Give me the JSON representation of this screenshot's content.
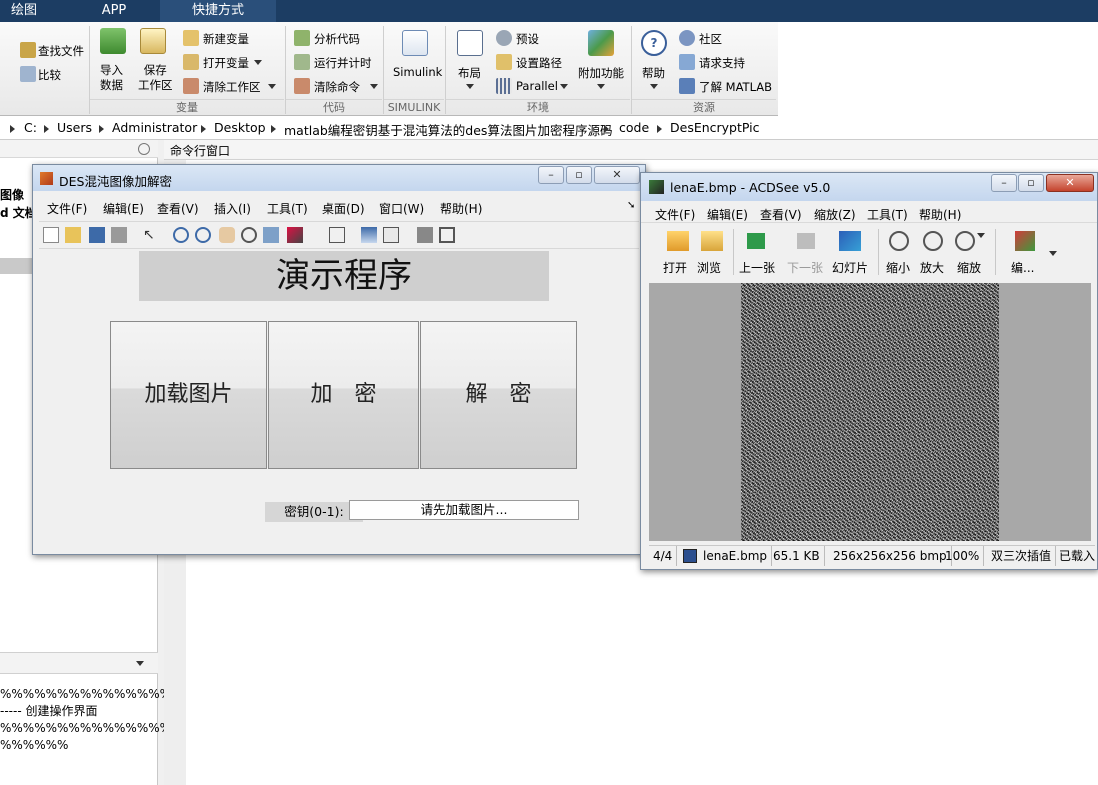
{
  "top_tabs": [
    "绘图",
    "APP",
    "快捷方式"
  ],
  "ribbon": {
    "left_items": [
      "查找文件",
      "比较"
    ],
    "import_label": "导入\n数据",
    "save_ws_label": "保存\n工作区",
    "new_var": "新建变量",
    "open_var": "打开变量",
    "clear_ws": "清除工作区",
    "group_var": "变量",
    "analyze_code": "分析代码",
    "run_time": "运行并计时",
    "clear_cmd": "清除命令",
    "group_code": "代码",
    "simulink": "Simulink",
    "group_simulink": "SIMULINK",
    "layout": "布局",
    "prefs": "预设",
    "set_path": "设置路径",
    "parallel": "Parallel",
    "addons": "附加功能",
    "group_env": "环境",
    "help": "帮助",
    "community": "社区",
    "request_support": "请求支持",
    "learn_matlab": "了解 MATLAB",
    "group_resources": "资源"
  },
  "address": [
    "C:",
    "Users",
    "Administrator",
    "Desktop",
    "matlab编程密钥基于混沌算法的des算法图片加密程序源码",
    "code",
    "DesEncryptPic"
  ],
  "left_panel": {
    "frag1": "图像",
    "frag2": "d 文档",
    "lines": [
      "%%%%%%%%%%%%%%%%",
      "----- 创建操作界面",
      "%%%%%%%%%%%%%%%%%",
      "%%%%%%"
    ]
  },
  "cmd_window_title": "命令行窗口",
  "des_window": {
    "title": "DES混沌图像加解密",
    "menu": [
      "文件(F)",
      "编辑(E)",
      "查看(V)",
      "插入(I)",
      "工具(T)",
      "桌面(D)",
      "窗口(W)",
      "帮助(H)"
    ],
    "heading": "演示程序",
    "btn_load": "加载图片",
    "btn_encrypt": "加　密",
    "btn_decrypt": "解　密",
    "key_label": "密钥(0-1):",
    "key_placeholder": "请先加载图片..."
  },
  "acdsee": {
    "title": "lenaE.bmp - ACDSee v5.0",
    "menu": [
      "文件(F)",
      "编辑(E)",
      "查看(V)",
      "缩放(Z)",
      "工具(T)",
      "帮助(H)"
    ],
    "toolbar": [
      "打开",
      "浏览",
      "上一张",
      "下一张",
      "幻灯片",
      "缩小",
      "放大",
      "缩放",
      "编..."
    ],
    "status": {
      "index": "4/4",
      "file": "lenaE.bmp",
      "size": "65.1 KB",
      "dims": "256x256x256 bmp",
      "zoom": "100%",
      "interp": "双三次插值",
      "loaded": "已载入"
    }
  },
  "colors": {
    "topbar": "#1c3d63",
    "accent_tab": "#355f8f",
    "titlebar": "#c4d6ee"
  }
}
